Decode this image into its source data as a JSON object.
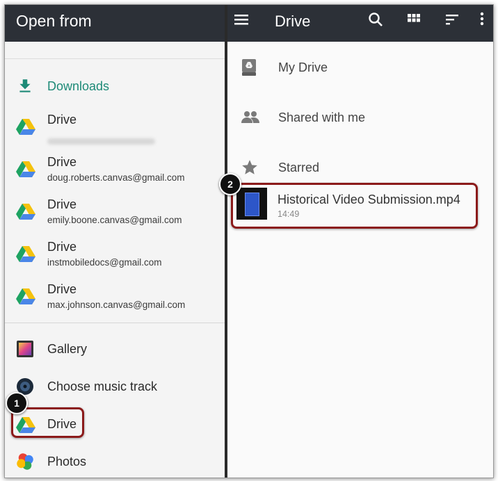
{
  "left_panel": {
    "title": "Open from",
    "downloads_label": "Downloads",
    "accounts": [
      {
        "label": "Drive",
        "email": ""
      },
      {
        "label": "Drive",
        "email": "doug.roberts.canvas@gmail.com"
      },
      {
        "label": "Drive",
        "email": "emily.boone.canvas@gmail.com"
      },
      {
        "label": "Drive",
        "email": "instmobiledocs@gmail.com"
      },
      {
        "label": "Drive",
        "email": "max.johnson.canvas@gmail.com"
      }
    ],
    "apps": [
      {
        "label": "Gallery",
        "icon": "gallery-icon"
      },
      {
        "label": "Choose music track",
        "icon": "music-icon"
      },
      {
        "label": "Drive",
        "icon": "drive-icon"
      },
      {
        "label": "Photos",
        "icon": "photos-icon"
      }
    ]
  },
  "right_panel": {
    "title": "Drive",
    "header_icons": [
      "menu-icon",
      "search-icon",
      "grid-view-icon",
      "sort-icon",
      "more-vert-icon"
    ],
    "nav": [
      {
        "label": "My Drive",
        "icon": "my-drive-icon"
      },
      {
        "label": "Shared with me",
        "icon": "shared-icon"
      },
      {
        "label": "Starred",
        "icon": "star-icon"
      }
    ],
    "file": {
      "name": "Historical Video Submission.mp4",
      "meta": "14:49"
    }
  },
  "callouts": {
    "one": "1",
    "two": "2"
  },
  "colors": {
    "header_bg": "#2c3037",
    "accent_green": "#1d8a77",
    "callout_red": "#8b1a1a"
  }
}
